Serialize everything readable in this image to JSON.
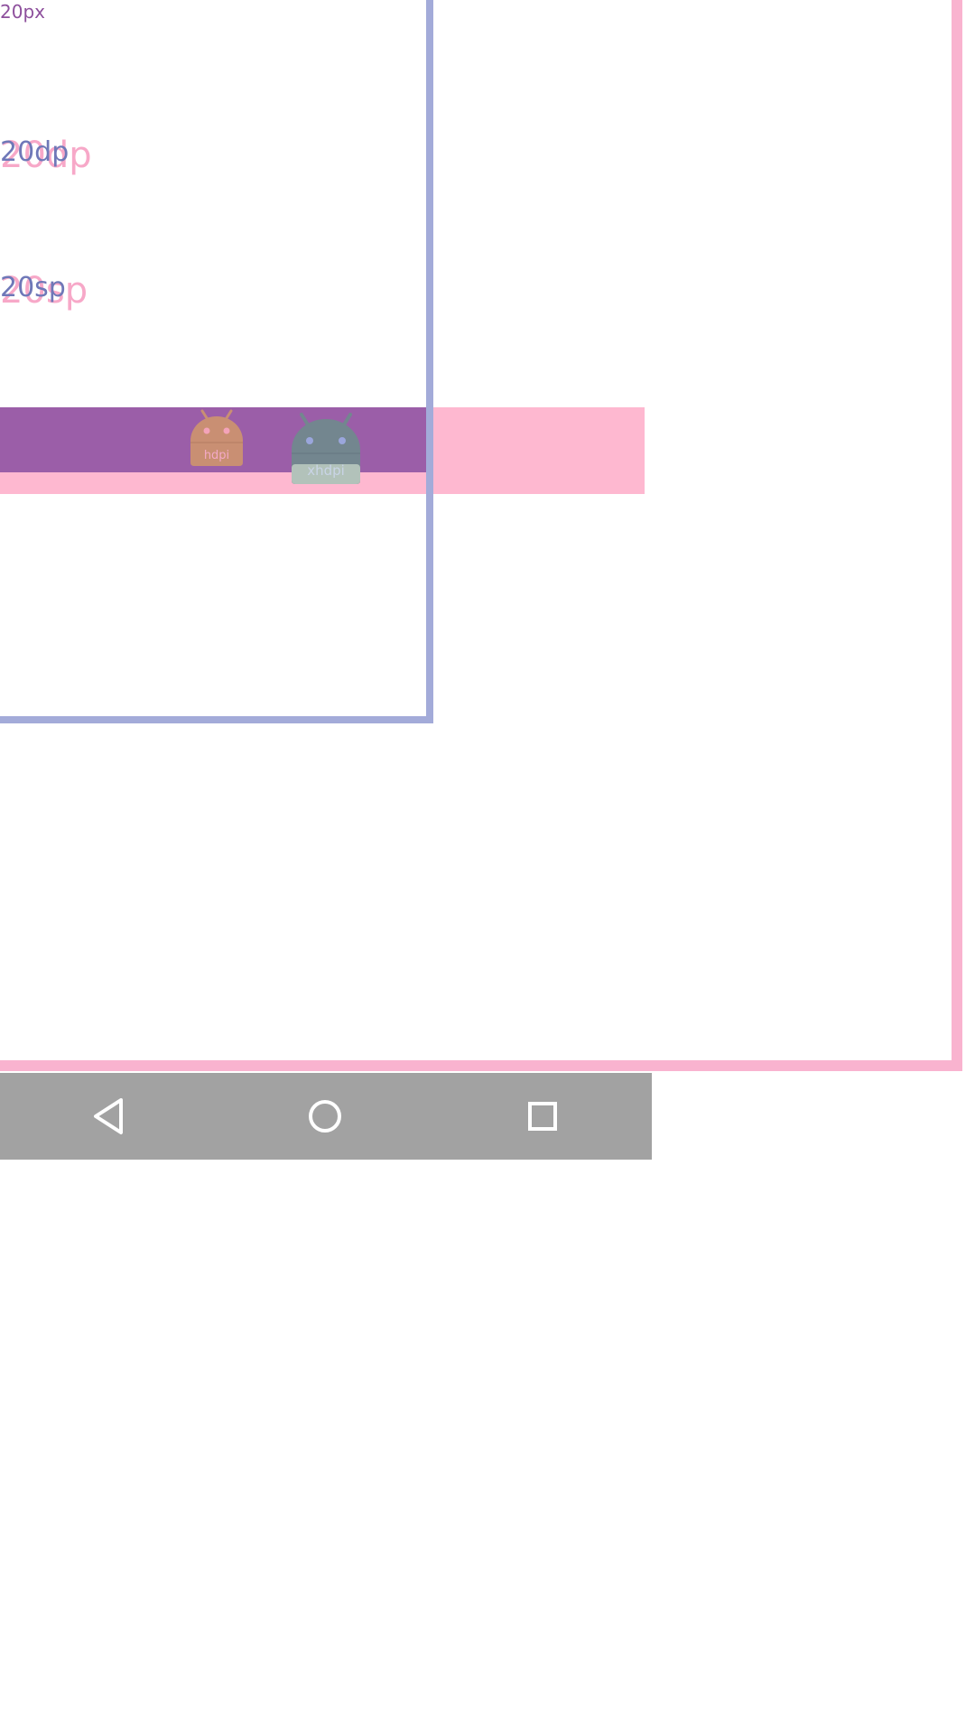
{
  "labels": {
    "px": "20px",
    "dp": "20dp",
    "sp": "20sp"
  },
  "badges": {
    "hdpi": "hdpi",
    "xhdpi": "xhdpi"
  },
  "colors": {
    "pink_frame": "#f9b3cf",
    "blue_frame": "#a3abd9",
    "pink_band": "#feb8d0",
    "purple_band": "#9b5ea8",
    "hdpi_droid": "#c98f73",
    "xhdpi_droid": "#73868f",
    "nav_bar": "#a2a2a2"
  },
  "nav": {
    "back_icon": "back-triangle-icon",
    "home_icon": "home-circle-icon",
    "recent_icon": "recents-square-icon"
  }
}
